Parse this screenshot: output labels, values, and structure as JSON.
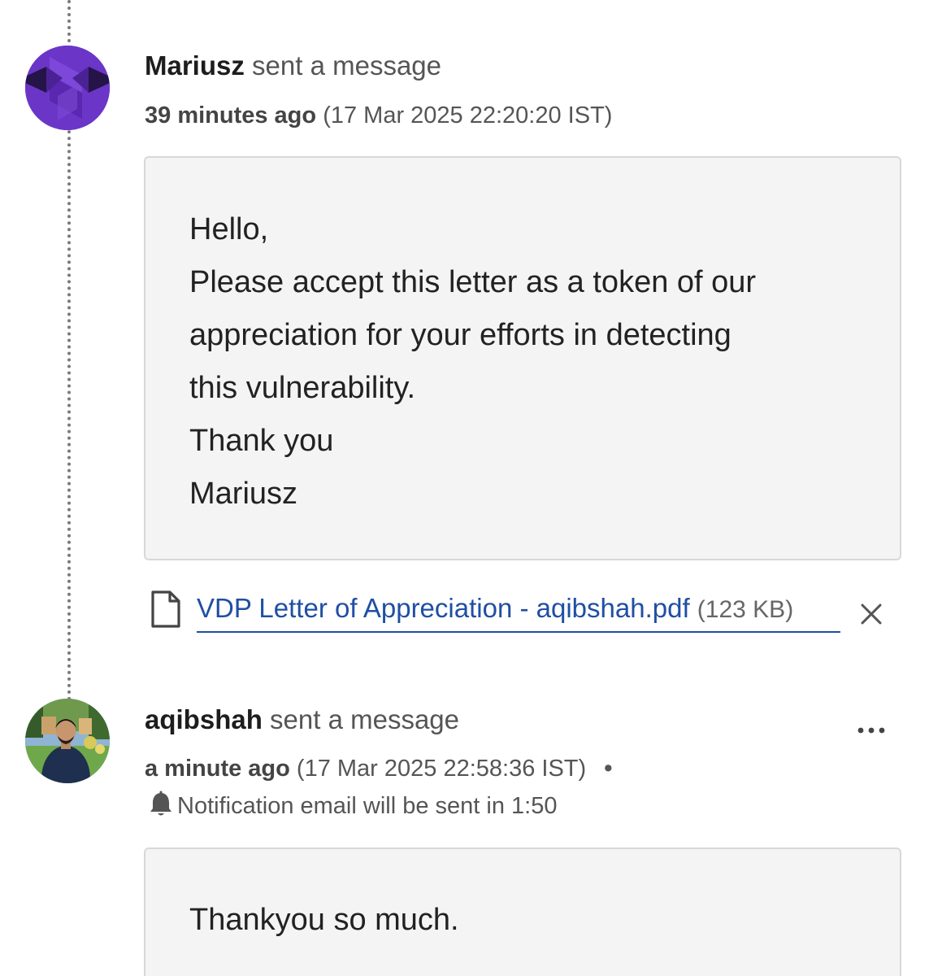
{
  "timeline": {
    "events": [
      {
        "author": "Mariusz",
        "action": "sent a message",
        "relative_time": "39 minutes ago",
        "absolute_time": "(17 Mar 2025 22:20:20 IST)",
        "avatar": "purple-logo-avatar",
        "message_lines": [
          "Hello,",
          "Please accept this letter as a token of our",
          "appreciation for your efforts in detecting",
          "this vulnerability.",
          "Thank you",
          "Mariusz"
        ],
        "attachment": {
          "icon": "file-icon",
          "name": "VDP Letter of Appreciation - aqibshah.pdf",
          "size": "(123 KB)",
          "remove_icon": "close-icon"
        }
      },
      {
        "author": "aqibshah",
        "action": "sent a message",
        "relative_time": "a minute ago",
        "absolute_time": "(17 Mar 2025 22:58:36 IST)",
        "separator": "•",
        "avatar": "user-photo-avatar",
        "more_icon": "more-options-icon",
        "notification": {
          "icon": "bell-icon",
          "text": "Notification email will be sent in 1:50"
        },
        "message_lines": [
          "Thankyou so much."
        ]
      }
    ]
  }
}
